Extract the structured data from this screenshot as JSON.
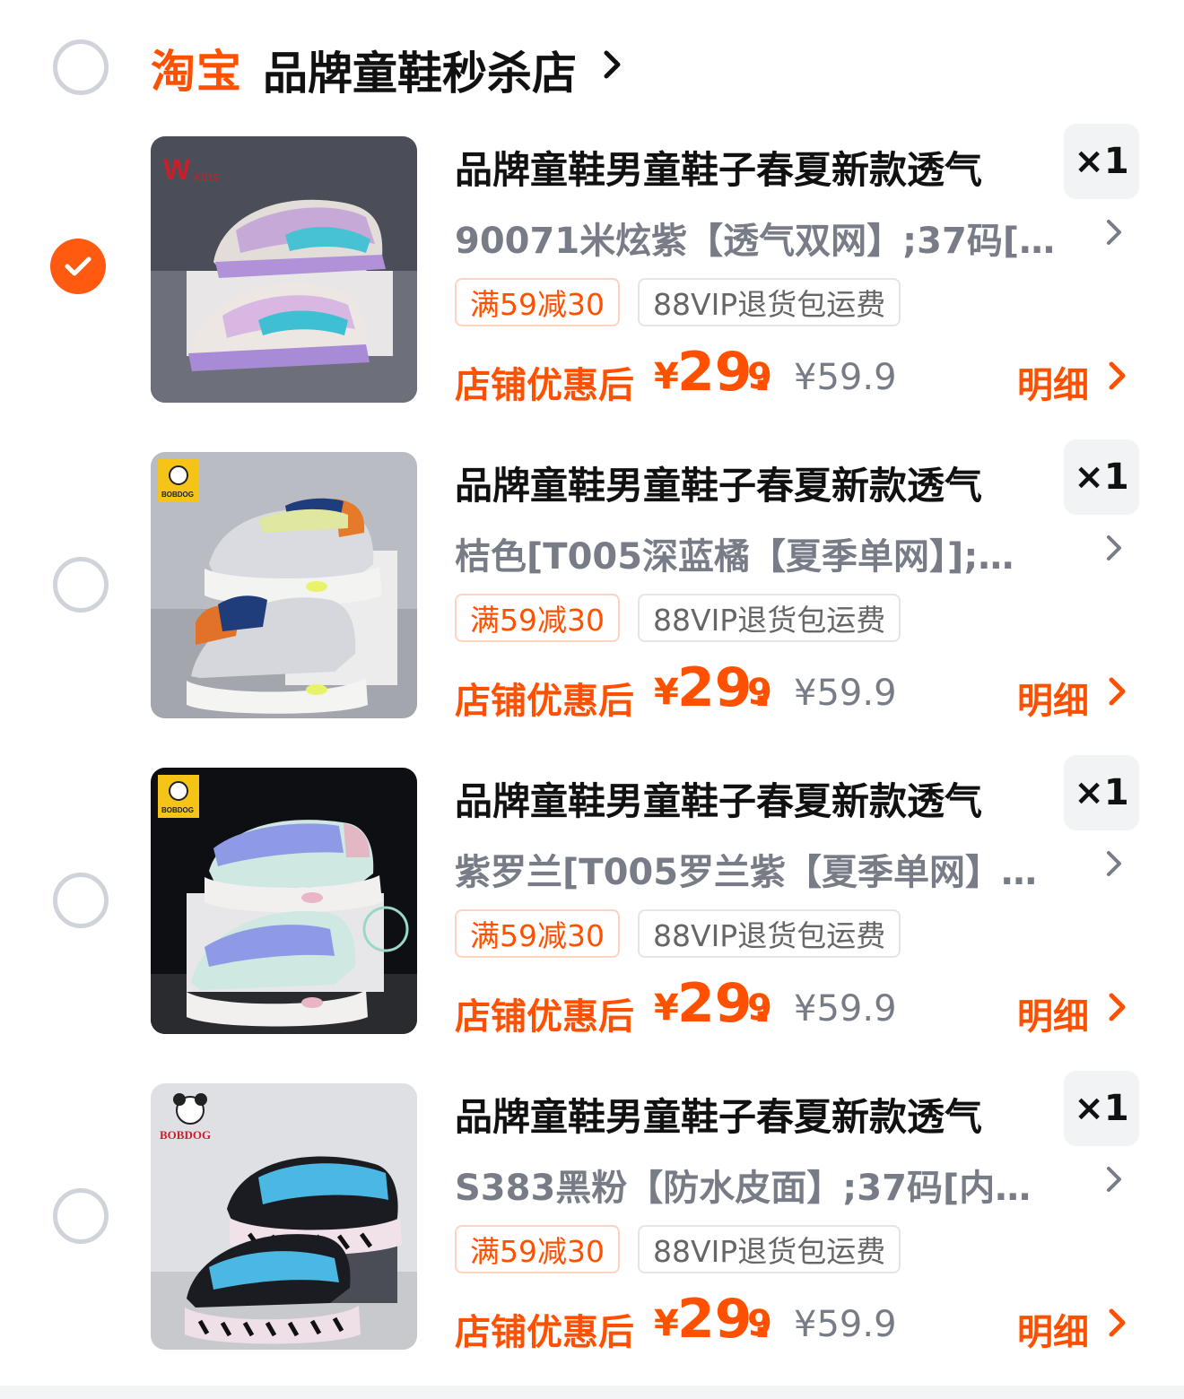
{
  "shop": {
    "logo": "淘宝",
    "name": "品牌童鞋秒杀店",
    "selected": false
  },
  "items": [
    {
      "title": "品牌童鞋男童鞋子春夏新款透气",
      "qty": "×1",
      "sku": "90071米炫紫【透气双网】;37码[…",
      "promo": "满59减30",
      "vip": "88VIP退货包运费",
      "price_prefix": "店铺优惠后",
      "price_yen": "¥",
      "price_int": "29.",
      "price_dec": "9",
      "original_price": "¥59.9",
      "detail": "明细",
      "selected": true
    },
    {
      "title": "品牌童鞋男童鞋子春夏新款透气",
      "qty": "×1",
      "sku": "桔色[T005深蓝橘【夏季单网】];…",
      "promo": "满59减30",
      "vip": "88VIP退货包运费",
      "price_prefix": "店铺优惠后",
      "price_yen": "¥",
      "price_int": "29.",
      "price_dec": "9",
      "original_price": "¥59.9",
      "detail": "明细",
      "selected": false
    },
    {
      "title": "品牌童鞋男童鞋子春夏新款透气",
      "qty": "×1",
      "sku": "紫罗兰[T005罗兰紫【夏季单网】…",
      "promo": "满59减30",
      "vip": "88VIP退货包运费",
      "price_prefix": "店铺优惠后",
      "price_yen": "¥",
      "price_int": "29.",
      "price_dec": "9",
      "original_price": "¥59.9",
      "detail": "明细",
      "selected": false
    },
    {
      "title": "品牌童鞋男童鞋子春夏新款透气",
      "qty": "×1",
      "sku": "S383黑粉【防水皮面】;37码[内…",
      "promo": "满59减30",
      "vip": "88VIP退货包运费",
      "price_prefix": "店铺优惠后",
      "price_yen": "¥",
      "price_int": "29.",
      "price_dec": "9",
      "original_price": "¥59.9",
      "detail": "明细",
      "selected": false
    }
  ],
  "colors": {
    "accent": "#ff5000",
    "checked": "#ff5a10",
    "muted_text": "#777c86",
    "radio_border": "#d0d3d9"
  }
}
